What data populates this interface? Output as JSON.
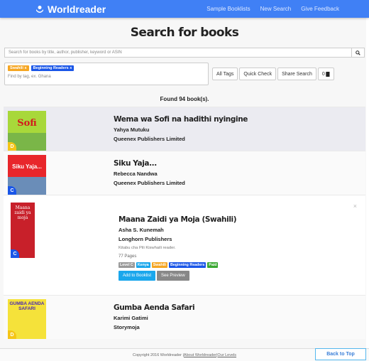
{
  "navbar": {
    "brand": "Worldreader",
    "links": [
      "Sample Booklists",
      "New Search",
      "Give Feedback"
    ]
  },
  "page_title": "Search for books",
  "search": {
    "placeholder": "Search for books by title, author, publisher, keyword or ASIN",
    "value": ""
  },
  "filters": {
    "tags": [
      {
        "label": "Swahili",
        "remove": "x",
        "color": "#f5a623"
      },
      {
        "label": "Beginning Readers",
        "remove": "x",
        "color": "#1a56e8"
      }
    ],
    "tag_placeholder": "Find by tag, ex. Ghana",
    "buttons": {
      "all_tags": "All Tags",
      "quick_check": "Quick Check",
      "share_search": "Share Search",
      "booklist_count": "0"
    }
  },
  "found_text": "Found 94 book(s).",
  "books": [
    {
      "title": "Wema wa Sofi na hadithi nyingine",
      "author": "Yahya Mutuku",
      "publisher": "Queenex Publishers Limited",
      "level": "D",
      "cover_text": "Sofi"
    },
    {
      "title": "Siku Yaja...",
      "author": "Rebecca Nandwa",
      "publisher": "Queenex Publishers Limited",
      "level": "C",
      "cover_text": "Siku Yaja..."
    },
    {
      "title": "Maana Zaidi ya Moja (Swahili)",
      "author": "Asha S. Kunemah",
      "publisher": "Longhorn Publishers",
      "level": "C",
      "cover_text": "Maana zaidi ya moja",
      "description": "Kitabu cha Pili Kiswhaili reader.",
      "pages": "77 Pages",
      "badges": [
        {
          "label": "Level C",
          "color": "#999999"
        },
        {
          "label": "Kenya",
          "color": "#1aa7ec"
        },
        {
          "label": "Swahili",
          "color": "#f5a623"
        },
        {
          "label": "Beginning Readers",
          "color": "#1a56e8"
        },
        {
          "label": "Paid",
          "color": "#3aa832"
        }
      ],
      "add_label": "Add to Booklist",
      "preview_label": "See Preview",
      "close": "×"
    },
    {
      "title": "Gumba Aenda Safari",
      "author": "Karimi Gatimi",
      "publisher": "Storymoja",
      "level": "D",
      "cover_text": "GUMBA AENDA SAFARI"
    }
  ],
  "footer": {
    "copyright": "Copyright 2016 Worldreader | ",
    "about": "About Worldreader",
    "sep": " | ",
    "levels": "Our Levels",
    "back_to_top": "Back to Top"
  },
  "colors": {
    "accent": "#4080f5",
    "add_btn": "#1aa7ec",
    "preview_btn": "#888888"
  }
}
